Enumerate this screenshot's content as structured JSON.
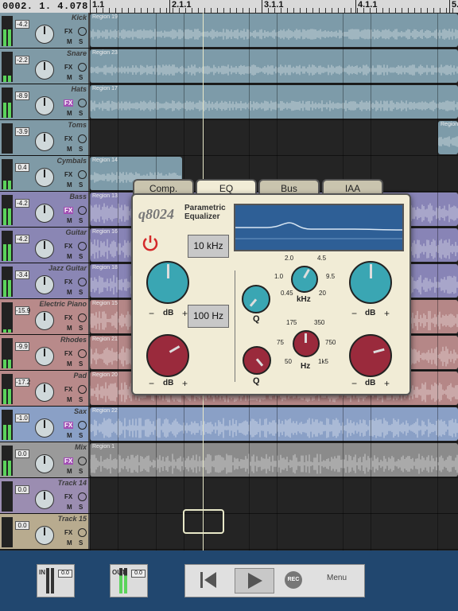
{
  "position": "0002. 1. 4.078",
  "ruler_labels": [
    "1.1",
    "2.1.1",
    "3.1.1",
    "4.1.1",
    "5."
  ],
  "tracks": [
    {
      "name": "Kick",
      "vol": "-4.2",
      "fx": "FX",
      "fx_on": false,
      "m": "M",
      "s": "S",
      "color": "#7f9aa6",
      "region_color": "#7d9ba9",
      "regions": [
        {
          "label": "Region 19"
        }
      ]
    },
    {
      "name": "Snare",
      "vol": "-2.2",
      "fx": "FX",
      "fx_on": false,
      "m": "M",
      "s": "S",
      "color": "#7f9aa6",
      "region_color": "#7d9ba9",
      "regions": [
        {
          "label": "Region 23"
        }
      ]
    },
    {
      "name": "Hats",
      "vol": "-8.9",
      "fx": "FX",
      "fx_on": true,
      "m": "M",
      "s": "S",
      "color": "#7f9aa6",
      "region_color": "#7d9ba9",
      "regions": [
        {
          "label": "Region 17"
        }
      ]
    },
    {
      "name": "Toms",
      "vol": "-3.9",
      "fx": "FX",
      "fx_on": false,
      "m": "M",
      "s": "S",
      "color": "#7f9aa6",
      "region_color": "#7d9ba9",
      "regions": [
        {
          "label": "Region"
        }
      ]
    },
    {
      "name": "Cymbals",
      "vol": "0.4",
      "fx": "FX",
      "fx_on": false,
      "m": "M",
      "s": "S",
      "color": "#7f9aa6",
      "region_color": "#7d9ba9",
      "regions": [
        {
          "label": "Region 14"
        }
      ]
    },
    {
      "name": "Bass",
      "vol": "-4.2",
      "fx": "FX",
      "fx_on": true,
      "m": "M",
      "s": "S",
      "color": "#8a86b4",
      "region_color": "#8884b6",
      "regions": [
        {
          "label": "Region 13"
        }
      ]
    },
    {
      "name": "Guitar",
      "vol": "-4.2",
      "fx": "FX",
      "fx_on": false,
      "m": "M",
      "s": "S",
      "color": "#8a86b4",
      "region_color": "#8884b6",
      "regions": [
        {
          "label": "Region 16"
        }
      ]
    },
    {
      "name": "Jazz Guitar",
      "vol": "-3.4",
      "fx": "FX",
      "fx_on": false,
      "m": "M",
      "s": "S",
      "color": "#8a86b4",
      "region_color": "#8884b6",
      "regions": [
        {
          "label": "Region 18"
        }
      ]
    },
    {
      "name": "Electric Piano",
      "vol": "-15.9",
      "fx": "FX",
      "fx_on": false,
      "m": "M",
      "s": "S",
      "color": "#b88a8a",
      "region_color": "#b58787",
      "regions": [
        {
          "label": "Region 15"
        }
      ]
    },
    {
      "name": "Rhodes",
      "vol": "-9.9",
      "fx": "FX",
      "fx_on": false,
      "m": "M",
      "s": "S",
      "color": "#b88a8a",
      "region_color": "#b58787",
      "regions": [
        {
          "label": "Region 21"
        }
      ]
    },
    {
      "name": "Pad",
      "vol": "-17.2",
      "fx": "FX",
      "fx_on": false,
      "m": "M",
      "s": "S",
      "color": "#b88a8a",
      "region_color": "#b58787",
      "regions": [
        {
          "label": "Region 20"
        }
      ]
    },
    {
      "name": "Sax",
      "vol": "-1.0",
      "fx": "FX",
      "fx_on": true,
      "m": "M",
      "s": "S",
      "color": "#8aa0c6",
      "region_color": "#8aa0c6",
      "regions": [
        {
          "label": "Region 22"
        }
      ]
    },
    {
      "name": "Mix",
      "vol": "0.0",
      "fx": "FX",
      "fx_on": true,
      "m": "M",
      "s": "S",
      "color": "#9a9a9a",
      "region_color": "#8b8b8b",
      "regions": [
        {
          "label": "Region 1"
        }
      ]
    },
    {
      "name": "Track 14",
      "vol": "0.0",
      "fx": "FX",
      "fx_on": false,
      "m": "M",
      "s": "S",
      "color": "#9b8db1",
      "region_color": "",
      "regions": []
    },
    {
      "name": "Track 15",
      "vol": "0.0",
      "fx": "FX",
      "fx_on": false,
      "m": "M",
      "s": "S",
      "color": "#b8ab8f",
      "region_color": "",
      "regions": []
    }
  ],
  "eq": {
    "tabs": [
      "Comp.",
      "EQ",
      "Bus",
      "IAA"
    ],
    "active_tab": "EQ",
    "title": "q8024",
    "subtitle_1": "Parametric",
    "subtitle_2": "Equalizer",
    "high_freq": "10 kHz",
    "low_freq": "100 Hz",
    "db_label": "dB",
    "minus": "−",
    "plus": "+",
    "q_label": "Q",
    "khz_label": "kHz",
    "hz_label": "Hz",
    "khz_scale": [
      "2.0",
      "4.5",
      "1.0",
      "9.5",
      "0.45",
      "20"
    ],
    "hz_scale": [
      "175",
      "350",
      "75",
      "750",
      "50",
      "1k5"
    ],
    "teal": "#3aa6b3",
    "red": "#9a2a3c"
  },
  "bottom": {
    "in_label": "IN",
    "out_label": "OUT",
    "in_value": "0.0",
    "out_value": "0.0",
    "rec_label": "REC",
    "menu_label": "Menu",
    "background": "#21476f"
  }
}
